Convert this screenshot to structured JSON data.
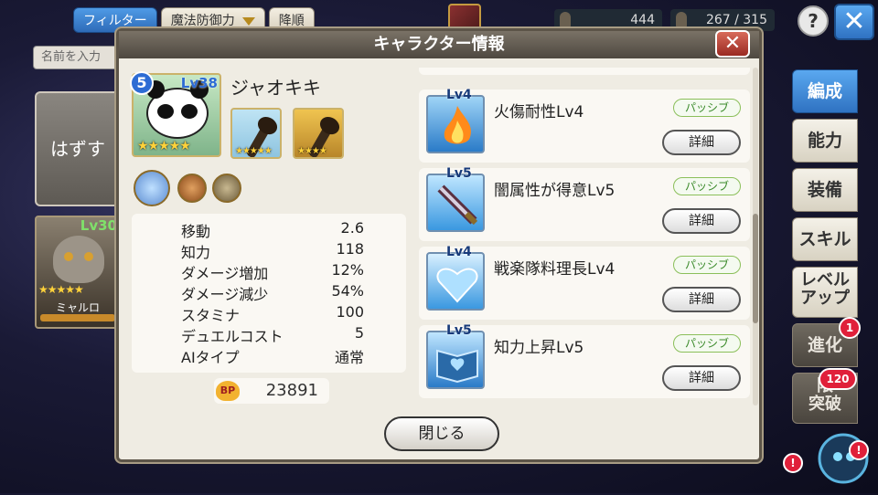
{
  "topbar": {
    "filter_label": "フィルター",
    "sort_field_label": "魔法防御力",
    "order_label": "降順",
    "count1": "444",
    "count2": "267 / 315",
    "help_label": "?",
    "close_label": "✕"
  },
  "left": {
    "name_input_placeholder": "名前を入力",
    "unequip_label": "はずす",
    "char_card": {
      "level": "Lv30",
      "stars": "★★★★★",
      "name": "ミャルロ"
    }
  },
  "side_tabs": [
    {
      "label": "編成",
      "active": true
    },
    {
      "label": "能力"
    },
    {
      "label": "装備"
    },
    {
      "label": "スキル"
    },
    {
      "label": "レベルアップ",
      "l1": "レベル",
      "l2": "アップ"
    },
    {
      "label": "進化",
      "badge": "1"
    },
    {
      "label": "限界突破",
      "l1": "限",
      "l2": "突破",
      "badge": "120"
    }
  ],
  "modal": {
    "title": "キャラクター情報",
    "close_icon": "✕",
    "rarity": "5",
    "level": "Lv38",
    "stars": "★★★★★",
    "name": "ジャオキキ",
    "equip1_stars": "★★★★★",
    "equip2_stars": "★★★★",
    "stats": [
      {
        "label": "移動",
        "value": "2.6"
      },
      {
        "label": "知力",
        "value": "118"
      },
      {
        "label": "ダメージ増加",
        "value": "12%"
      },
      {
        "label": "ダメージ減少",
        "value": "54%"
      },
      {
        "label": "スタミナ",
        "value": "100"
      },
      {
        "label": "デュエルコスト",
        "value": "5"
      },
      {
        "label": "AIタイプ",
        "value": "通常"
      }
    ],
    "bp_label": "BP",
    "bp_value": "23891",
    "skills": [
      {
        "level": "Lv4",
        "name": "火傷耐性Lv4",
        "type": "パッシブ",
        "detail": "詳細",
        "icon": "fire-icon"
      },
      {
        "level": "Lv5",
        "name": "闇属性が得意Lv5",
        "type": "パッシブ",
        "detail": "詳細",
        "icon": "dark-sword-icon"
      },
      {
        "level": "Lv4",
        "name": "戦楽隊料理長Lv4",
        "type": "パッシブ",
        "detail": "詳細",
        "icon": "heart-gem-icon"
      },
      {
        "level": "Lv5",
        "name": "知力上昇Lv5",
        "type": "パッシブ",
        "detail": "詳細",
        "icon": "book-icon"
      }
    ],
    "close_button": "閉じる"
  },
  "robot_badge": "!",
  "robot_badge2": "!"
}
